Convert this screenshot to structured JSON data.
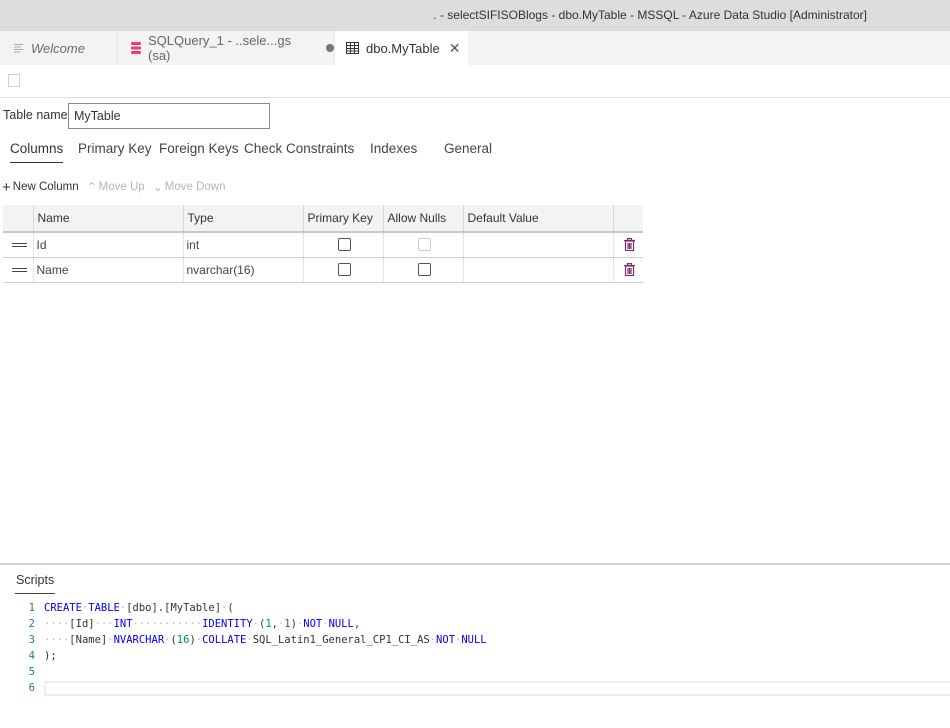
{
  "window": {
    "title": ". - selectSIFISOBlogs - dbo.MyTable - MSSQL - Azure Data Studio [Administrator]"
  },
  "tabs": [
    {
      "label": "Welcome",
      "icon": "document-lines-icon",
      "italic": true
    },
    {
      "label": "SQLQuery_1 - ..sele...gs (sa)",
      "icon": "database-icon",
      "icon_color": "#e8416d",
      "dirty": true
    },
    {
      "label": "dbo.MyTable",
      "icon": "table-grid-icon",
      "active": true,
      "close_glyph": "✕"
    }
  ],
  "toolbar": {
    "save_icon": "publish-save-icon"
  },
  "table_name": {
    "label": "Table name",
    "value": "MyTable"
  },
  "designer_tabs": [
    {
      "label": "Columns",
      "active": true
    },
    {
      "label": "Primary Key"
    },
    {
      "label": "Foreign Keys"
    },
    {
      "label": "Check Constraints"
    },
    {
      "label": "Indexes"
    },
    {
      "label": "General"
    }
  ],
  "column_tools": {
    "new_column": {
      "label": "New Column",
      "glyph": "+",
      "enabled": true
    },
    "move_up": {
      "label": "Move Up",
      "glyph": "⌃",
      "enabled": false
    },
    "move_down": {
      "label": "Move Down",
      "glyph": "⌄",
      "enabled": false
    }
  },
  "columns_grid": {
    "headers": [
      "",
      "Name",
      "Type",
      "Primary Key",
      "Allow Nulls",
      "Default Value",
      ""
    ],
    "rows": [
      {
        "name": "Id",
        "type": "int",
        "primary_key": false,
        "allow_nulls": false,
        "allow_nulls_disabled": true,
        "default_value": ""
      },
      {
        "name": "Name",
        "type": "nvarchar(16)",
        "primary_key": false,
        "allow_nulls": false,
        "allow_nulls_disabled": false,
        "default_value": ""
      }
    ],
    "delete_icon_color": "#7a2e6e"
  },
  "scripts": {
    "label": "Scripts",
    "lines": [
      {
        "n": "1"
      },
      {
        "n": "2"
      },
      {
        "n": "3"
      },
      {
        "n": "4"
      },
      {
        "n": "5"
      },
      {
        "n": "6"
      }
    ],
    "tokens": {
      "l1": [
        "CREATE",
        "TABLE",
        "[dbo].[MyTable]",
        "("
      ],
      "l2": [
        "[Id]",
        "INT",
        "IDENTITY",
        "(",
        "1",
        ",",
        "1",
        ")",
        "NOT",
        "NULL",
        ","
      ],
      "l3": [
        "[Name]",
        "NVARCHAR",
        "(",
        "16",
        ")",
        "COLLATE",
        "SQL_Latin1_General_CP1_CI_AS",
        "NOT",
        "NULL"
      ],
      "l4": [
        ");"
      ]
    }
  },
  "colors": {
    "keyword": "#0000ff",
    "number": "#098658",
    "line_number": "#237893"
  }
}
